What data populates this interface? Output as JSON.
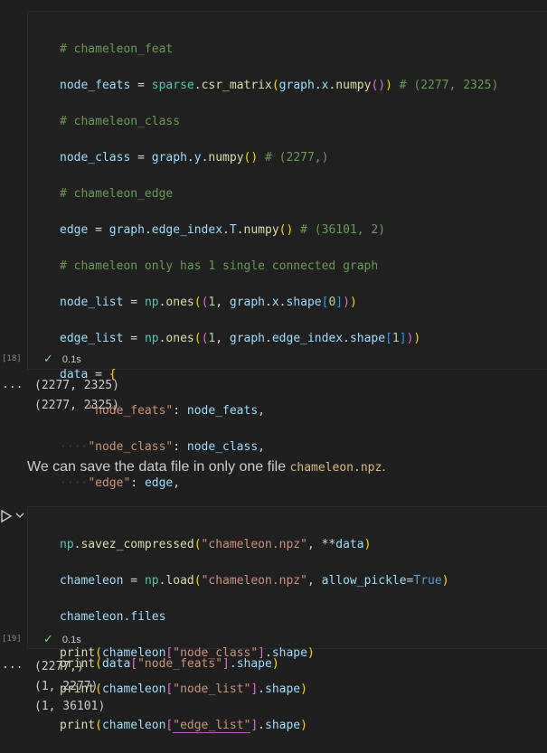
{
  "cell18": {
    "exec_count": "[18]",
    "time": "0.1s",
    "output": [
      "(2277, 2325)",
      "(2277, 2325)"
    ]
  },
  "markdown": {
    "text": "We can save the data file in only one file ",
    "code": "chameleon.npz",
    "end": "."
  },
  "cell19": {
    "exec_count": "[19]",
    "time": "0.1s",
    "output": [
      "(2277,)",
      "(1, 2277)",
      "(1, 36101)"
    ]
  },
  "output_ellipsis": "...",
  "icons": {
    "check": "check-icon",
    "run": "run-icon",
    "chevron": "chevron-down-icon"
  }
}
